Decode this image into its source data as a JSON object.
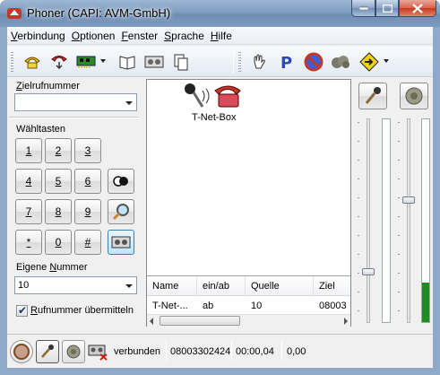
{
  "window": {
    "title": "Phoner (CAPI: AVM-GmbH)"
  },
  "menu": [
    {
      "accel": "V",
      "rest": "erbindung"
    },
    {
      "accel": "O",
      "rest": "ptionen"
    },
    {
      "accel": "F",
      "rest": "enster"
    },
    {
      "accel": "S",
      "rest": "prache"
    },
    {
      "accel": "H",
      "rest": "ilfe"
    }
  ],
  "left": {
    "zielrufnummer_accel": "Z",
    "zielrufnummer_rest": "ielrufnummer",
    "zielrufnummer_value": "",
    "waehltasten_label": "Wähltasten",
    "keys": [
      "1",
      "2",
      "3",
      "4",
      "5",
      "6",
      "7",
      "8",
      "9",
      "*",
      "0",
      "#"
    ],
    "eigene_nummer_prefix": "Eigene ",
    "eigene_nummer_accel": "N",
    "eigene_nummer_rest": "ummer",
    "eigene_nummer_value": "10",
    "rufnummer_accel": "R",
    "rufnummer_rest": "ufnummer übermitteln",
    "rufnummer_checked": true
  },
  "center": {
    "device_label": "T-Net-Box",
    "columns": [
      "Name",
      "ein/ab",
      "Quelle",
      "Ziel"
    ],
    "rows": [
      {
        "name": "T-Net-...",
        "direction": "ab",
        "source": "10",
        "target": "08003"
      }
    ]
  },
  "right": {
    "microphone_level": 0.25,
    "speaker_level": 0.18
  },
  "status": {
    "state": "verbunden",
    "number": "08003302424",
    "duration": "00:00,04",
    "cost": "0,00"
  },
  "colors": {
    "title_gradient": "#7f9cbf",
    "close_button": "#c0391d",
    "level_fill": "#1e8c1e",
    "selected_key": "#bee6fd"
  }
}
